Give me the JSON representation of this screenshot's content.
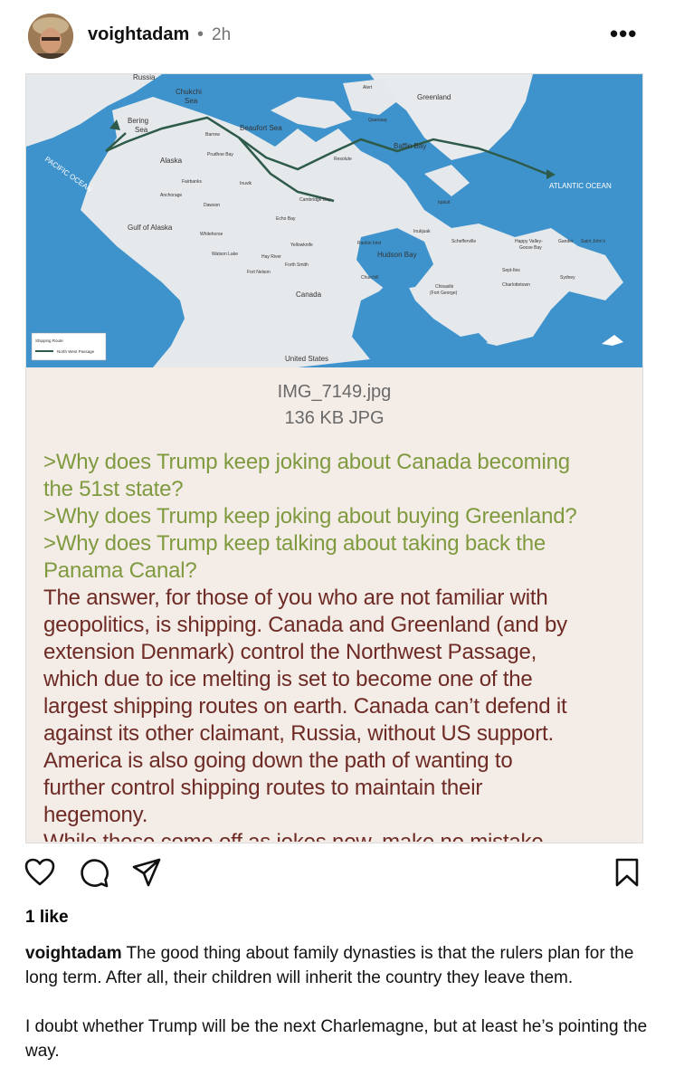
{
  "post": {
    "username": "voightadam",
    "separator": "•",
    "time": "2h",
    "more_label": "•••"
  },
  "image": {
    "filename": "IMG_7149.jpg",
    "filesize": "136 KB JPG",
    "map_labels": {
      "russia": "Russia",
      "chukchi": "Chukchi",
      "sea": "Sea",
      "bering": "Bering",
      "bering_sea": "Sea",
      "pacific": "PACIFIC OCEAN",
      "alaska": "Alaska",
      "barrow": "Barrow",
      "prudhoe": "Prudhoe Bay",
      "beaufort": "Beaufort Sea",
      "alert": "Alert",
      "greenland": "Greenland",
      "qaanaaq": "Qaanaaq",
      "baffin": "Baffin Bay",
      "resolute": "Resolute",
      "atlantic": "ATLANTIC OCEAN",
      "fairbanks": "Fairbanks",
      "inuvik": "Inuvik",
      "anchorage": "Anchorage",
      "dawson": "Dawson",
      "cambridge": "Cambridge Bay",
      "iqaluit": "Iqaluit",
      "gulf": "Gulf of Alaska",
      "whitehorse": "Whitehorse",
      "watson": "Watson Lake",
      "echo": "Echo Bay",
      "yellowknife": "Yellowknife",
      "hay": "Hay River",
      "fortsmith": "Forth Smith",
      "fortnelson": "Fort Nelson",
      "rankin": "Rankin Inlet",
      "inukjuak": "Inukjuak",
      "hudson": "Hudson Bay",
      "schefferville": "Schefferville",
      "happy": "Happy Valley-",
      "goose": "Goose Bay",
      "gander": "Gander",
      "stjohns": "Saint John's",
      "churchill": "Churchill",
      "chisasibi": "Chisasibi",
      "fortgeorge": "(Fort George)",
      "septiles": "Sept-Iles",
      "sydney": "Sydney",
      "charlottetown": "Charlottetown",
      "canada": "Canada",
      "us": "United States",
      "legend1": "Shipping Route",
      "legend2": "North West Passage"
    },
    "lines": [
      {
        "cls": "greentext",
        "text": ">Why does Trump keep joking about Canada becoming"
      },
      {
        "cls": "greentext",
        "text": "the 51st state?"
      },
      {
        "cls": "greentext",
        "text": ">Why does Trump keep joking about buying Greenland?"
      },
      {
        "cls": "greentext",
        "text": ">Why does Trump keep talking about taking back the"
      },
      {
        "cls": "greentext",
        "text": "Panama Canal?"
      },
      {
        "cls": "plain",
        "text": "The answer, for those of you who are not familiar with"
      },
      {
        "cls": "plain",
        "text": "geopolitics, is shipping. Canada and Greenland (and by"
      },
      {
        "cls": "plain",
        "text": "extension Denmark) control the Northwest Passage,"
      },
      {
        "cls": "plain",
        "text": "which due to ice melting is set to become one of the"
      },
      {
        "cls": "plain",
        "text": "largest shipping routes on earth. Canada can’t defend it"
      },
      {
        "cls": "plain",
        "text": "against its other claimant, Russia, without US support."
      },
      {
        "cls": "plain",
        "text": "America is also going down the path of wanting to"
      },
      {
        "cls": "plain",
        "text": "further control shipping routes to maintain their"
      },
      {
        "cls": "plain",
        "text": "hegemony."
      }
    ],
    "cut_line": "While these come off as jokes now, make no mistake"
  },
  "actions": {
    "like_icon": "heart-icon",
    "comment_icon": "comment-icon",
    "share_icon": "share-icon",
    "save_icon": "bookmark-icon"
  },
  "likes": "1 like",
  "caption": {
    "username": "voightadam",
    "text1": " The good thing about family dynasties is that the rulers plan for the long term. After all, their children will inherit the country they leave them.",
    "text2": "I doubt whether Trump will be the next Charlemagne, but at least he’s pointing the way."
  },
  "colors": {
    "greentext": "#7f9a3f",
    "plaintext": "#6e2a24",
    "ocean": "#3f93cc",
    "land": "#e6e9ec",
    "route": "#2e5a4a"
  }
}
